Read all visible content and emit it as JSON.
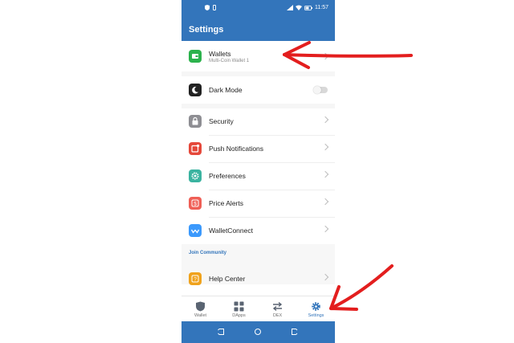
{
  "statusbar": {
    "time": "11:57",
    "battery": "47"
  },
  "header": {
    "title": "Settings"
  },
  "settings": {
    "wallets": {
      "label": "Wallets",
      "subtitle": "Multi-Coin Wallet 1"
    },
    "dark_mode": {
      "label": "Dark Mode",
      "enabled": false
    },
    "security": {
      "label": "Security"
    },
    "push": {
      "label": "Push Notifications"
    },
    "preferences": {
      "label": "Preferences"
    },
    "price_alerts": {
      "label": "Price Alerts"
    },
    "walletconnect": {
      "label": "WalletConnect"
    },
    "community_header": "Join Community",
    "help_center": {
      "label": "Help Center"
    }
  },
  "tabs": [
    {
      "label": "Wallet",
      "icon": "shield-icon"
    },
    {
      "label": "DApps",
      "icon": "grid-icon"
    },
    {
      "label": "DEX",
      "icon": "swap-icon"
    },
    {
      "label": "Settings",
      "icon": "gear-icon",
      "active": true
    }
  ],
  "colors": {
    "brand": "#3375bb",
    "wallets_icon": "#2bb24c",
    "dark_mode_icon": "#222222",
    "security_icon": "#8e8e93",
    "push_icon": "#e5483a",
    "preferences_icon": "#3bb3a0",
    "price_alerts_icon": "#ef5f56",
    "walletconnect_icon": "#3b99fc",
    "help_icon": "#f0a21c",
    "annotation_arrow": "#e31e1e"
  }
}
